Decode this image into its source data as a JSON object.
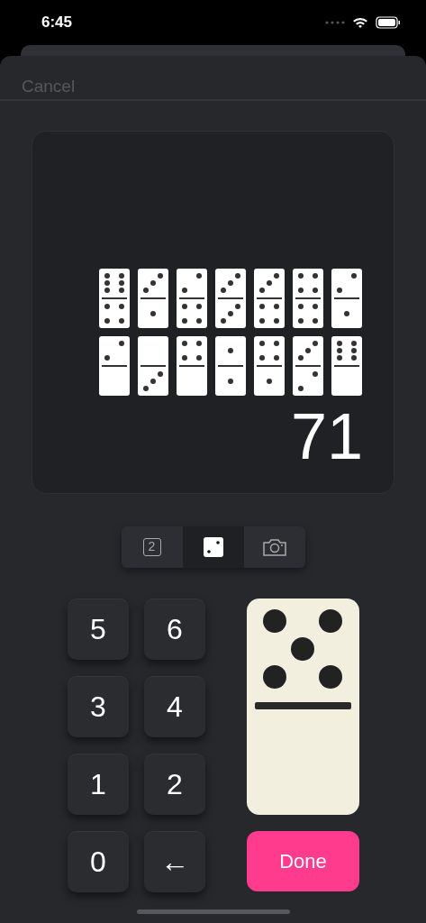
{
  "status_bar": {
    "time": "6:45"
  },
  "sheet": {
    "cancel": "Cancel"
  },
  "display": {
    "total": "71",
    "dominoes": [
      {
        "halves": [
          {
            "kind": "six"
          },
          {
            "kind": "four"
          }
        ]
      },
      {
        "halves": [
          {
            "kind": "three"
          },
          {
            "kind": "one"
          }
        ]
      },
      {
        "halves": [
          {
            "kind": "two"
          },
          {
            "kind": "four"
          }
        ]
      },
      {
        "halves": [
          {
            "kind": "three"
          },
          {
            "kind": "three"
          }
        ]
      },
      {
        "halves": [
          {
            "kind": "three"
          },
          {
            "kind": "four"
          }
        ]
      },
      {
        "halves": [
          {
            "kind": "four"
          },
          {
            "kind": "four"
          }
        ]
      },
      {
        "halves": [
          {
            "kind": "two"
          },
          {
            "kind": "one"
          }
        ]
      },
      {
        "halves": [
          {
            "kind": "two"
          },
          {
            "kind": "blank"
          }
        ]
      },
      {
        "halves": [
          {
            "kind": "blank"
          },
          {
            "kind": "three"
          }
        ]
      },
      {
        "halves": [
          {
            "kind": "four"
          },
          {
            "kind": "blank"
          }
        ]
      },
      {
        "halves": [
          {
            "kind": "one"
          },
          {
            "kind": "one"
          }
        ]
      },
      {
        "halves": [
          {
            "kind": "four"
          },
          {
            "kind": "one"
          }
        ]
      },
      {
        "halves": [
          {
            "kind": "three"
          },
          {
            "kind": "two"
          }
        ]
      },
      {
        "halves": [
          {
            "kind": "six"
          },
          {
            "kind": "blank"
          }
        ]
      }
    ]
  },
  "mode_selector": [
    {
      "kind": "number",
      "label": "2",
      "selected": false
    },
    {
      "kind": "dice",
      "selected": true
    },
    {
      "kind": "camera",
      "selected": false
    }
  ],
  "keypad": [
    "5",
    "6",
    "3",
    "4",
    "1",
    "2",
    "0",
    "←"
  ],
  "current_domino": {
    "halves": [
      {
        "kind": "five"
      },
      {
        "kind": "blank"
      }
    ]
  },
  "done_button": "Done"
}
